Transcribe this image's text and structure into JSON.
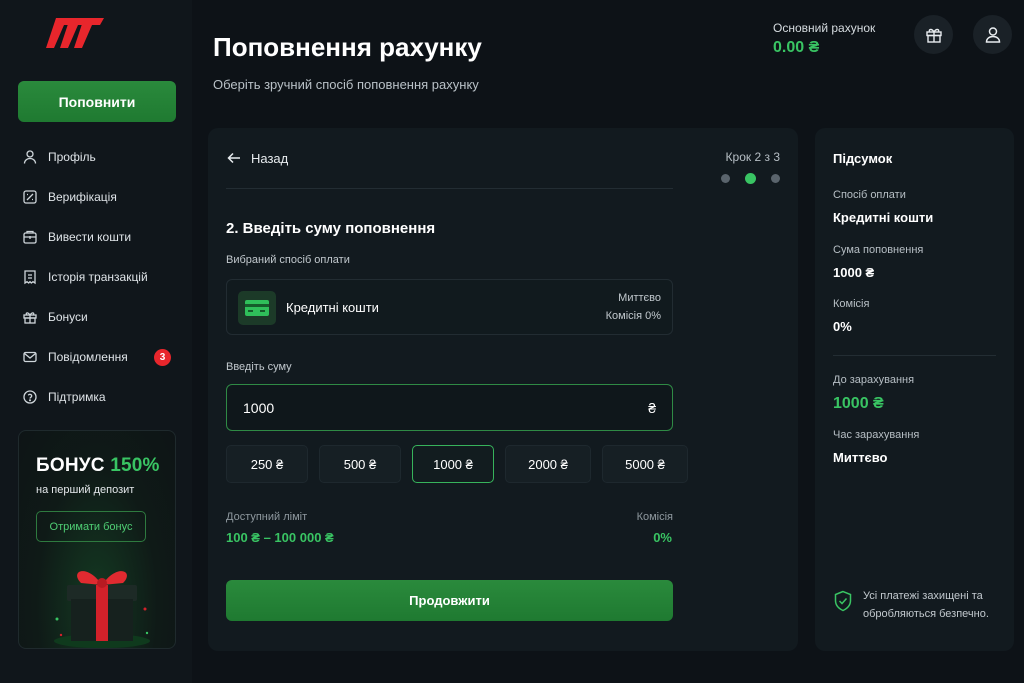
{
  "sidebar": {
    "deposit_button": "Поповнити",
    "items": [
      {
        "label": "Профіль",
        "icon": "user-icon"
      },
      {
        "label": "Верифікація",
        "icon": "verification-icon"
      },
      {
        "label": "Вивести кошти",
        "icon": "withdraw-icon"
      },
      {
        "label": "Історія транзакцій",
        "icon": "history-icon"
      },
      {
        "label": "Бонуси",
        "icon": "gift-icon"
      },
      {
        "label": "Повідомлення",
        "icon": "mail-icon",
        "badge": "3"
      },
      {
        "label": "Підтримка",
        "icon": "help-icon"
      }
    ],
    "promo": {
      "title_prefix": "БОНУС",
      "title_accent": "150%",
      "subtitle": "на перший депозит",
      "button": "Отримати бонус"
    }
  },
  "header": {
    "title": "Поповнення рахунку",
    "subtitle": "Оберіть зручний спосіб поповнення рахунку",
    "balance_label": "Основний рахунок",
    "balance_value": "0.00 ₴"
  },
  "form": {
    "back_label": "Назад",
    "step_label": "Крок 2 з 3",
    "section_title": "2. Введіть суму поповнення",
    "method_label": "Вибраний спосіб оплати",
    "method": {
      "name": "Кредитні кошти",
      "speed": "Миттєво",
      "fee": "Комісія 0%"
    },
    "amount_label": "Введіть суму",
    "amount_value": "1000",
    "currency": "₴",
    "presets": [
      "250 ₴",
      "500 ₴",
      "1000 ₴",
      "2000 ₴",
      "5000 ₴"
    ],
    "selected_preset": "1000 ₴",
    "limit_label": "Доступний ліміт",
    "limit_value": "100 ₴ – 100 000 ₴",
    "fee_label": "Комісія",
    "fee_value": "0%",
    "continue_button": "Продовжити"
  },
  "summary": {
    "title": "Підсумок",
    "method_label": "Спосіб оплати",
    "method_value": "Кредитні кошти",
    "amount_label": "Сума поповнення",
    "amount_value": "1000 ₴",
    "fee_label": "Комісія",
    "fee_value": "0%",
    "credit_label": "До зарахування",
    "credit_value": "1000 ₴",
    "time_label": "Час зарахування",
    "time_value": "Миттєво",
    "secure_text": "Усі платежі захищені та обробляються безпечно."
  },
  "colors": {
    "accent": "#39c463",
    "button": "#2a8a3c",
    "background": "#0d1217",
    "badge": "#e8262c"
  }
}
